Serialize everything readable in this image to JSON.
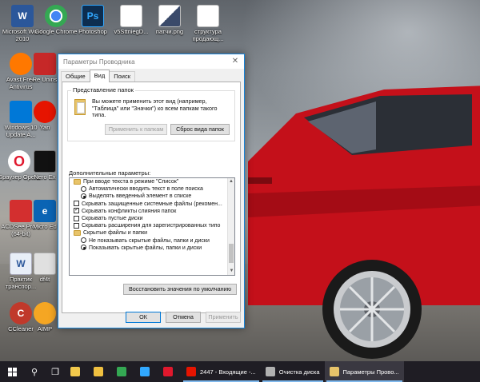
{
  "desktop": {
    "icons": [
      {
        "label": "Microsoft Word 2010",
        "icon": "word-icon",
        "color": "#2b579a",
        "glyph": "W"
      },
      {
        "label": "Google Chrome",
        "icon": "chrome-icon",
        "color": "#34a853",
        "glyph": ""
      },
      {
        "label": "Photoshop",
        "icon": "photoshop-icon",
        "color": "#0d2d4f",
        "glyph": "Ps"
      },
      {
        "label": "v5SttniegD...",
        "icon": "document-thumbnail-icon",
        "color": "#ffffff",
        "glyph": ""
      },
      {
        "label": "патчи.png",
        "icon": "image-thumbnail-icon",
        "color": "#ffffff",
        "glyph": ""
      },
      {
        "label": "структура продающ...",
        "icon": "image-thumbnail-icon",
        "color": "#ffffff",
        "glyph": ""
      },
      {
        "label": "Avast Free Antivirus",
        "icon": "avast-icon",
        "color": "#ff7800",
        "glyph": ""
      },
      {
        "label": "Re Unins",
        "icon": "uninstaller-icon",
        "color": "#c62828",
        "glyph": ""
      },
      {
        "label": "Windows 10 Update A...",
        "icon": "windows-update-icon",
        "color": "#0078d7",
        "glyph": ""
      },
      {
        "label": "Yan",
        "icon": "yandex-icon",
        "color": "#e61400",
        "glyph": ""
      },
      {
        "label": "Браузер Opera",
        "icon": "opera-icon",
        "color": "#e0182d",
        "glyph": "O"
      },
      {
        "label": "Nero Ex",
        "icon": "nero-icon",
        "color": "#111111",
        "glyph": ""
      },
      {
        "label": "ACDSee Pro 9 (64-bit)",
        "icon": "acdsee-icon",
        "color": "#d32f2f",
        "glyph": ""
      },
      {
        "label": "Micro Ed",
        "icon": "edge-icon",
        "color": "#0a64b4",
        "glyph": "e"
      },
      {
        "label": "Практик транспор...",
        "icon": "word-document-icon",
        "color": "#e8eef7",
        "glyph": "W"
      },
      {
        "label": "df4t",
        "icon": "document-icon",
        "color": "#e0e0e0",
        "glyph": ""
      },
      {
        "label": "CCleaner",
        "icon": "ccleaner-icon",
        "color": "#c0392b",
        "glyph": "C"
      },
      {
        "label": "AIMP",
        "icon": "aimp-icon",
        "color": "#f5a623",
        "glyph": ""
      }
    ]
  },
  "dialog": {
    "title": "Параметры Проводника",
    "tabs": [
      "Общие",
      "Вид",
      "Поиск"
    ],
    "active_tab": "Вид",
    "folder_views": {
      "label": "Представление папок",
      "description": "Вы можете применить этот вид (например, \"Таблица\" или \"Значки\") ко всем папкам такого типа.",
      "apply_button": "Применить к папкам",
      "reset_button": "Сброс вида папок"
    },
    "advanced_label": "Дополнительные параметры:",
    "advanced_items": [
      {
        "text": "При вводе текста в режиме \"Список\"",
        "kind": "folder",
        "level": 0
      },
      {
        "text": "Автоматически вводить текст в поле поиска",
        "kind": "radio",
        "checked": false,
        "level": 1
      },
      {
        "text": "Выделять введенный элемент в списке",
        "kind": "radio",
        "checked": true,
        "level": 1
      },
      {
        "text": "Скрывать защищенные системные файлы (рекомен...",
        "kind": "check",
        "checked": false,
        "level": 0
      },
      {
        "text": "Скрывать конфликты слияния папок",
        "kind": "check",
        "checked": true,
        "level": 0
      },
      {
        "text": "Скрывать пустые диски",
        "kind": "check",
        "checked": false,
        "level": 0
      },
      {
        "text": "Скрывать расширения для зарегистрированных типо",
        "kind": "check",
        "checked": false,
        "level": 0
      },
      {
        "text": "Скрытые файлы и папки",
        "kind": "folder",
        "level": 0
      },
      {
        "text": "Не показывать скрытые файлы, папки и диски",
        "kind": "radio",
        "checked": false,
        "level": 1
      },
      {
        "text": "Показывать скрытые файлы, папки и диски",
        "kind": "radio",
        "checked": true,
        "level": 1
      }
    ],
    "restore_button": "Восстановить значения по умолчанию",
    "ok_button": "ОК",
    "cancel_button": "Отмена",
    "apply_button": "Применить"
  },
  "taskbar": {
    "apps": [
      {
        "label": "",
        "icon": "steam-like-icon",
        "color": "#f2c94c"
      },
      {
        "label": "",
        "icon": "file-explorer-icon",
        "color": "#f0c040"
      },
      {
        "label": "",
        "icon": "chrome-icon",
        "color": "#34a853"
      },
      {
        "label": "",
        "icon": "photoshop-icon",
        "color": "#31a8ff"
      },
      {
        "label": "",
        "icon": "opera-icon",
        "color": "#e0182d"
      },
      {
        "label": "2447 - Входящие -...",
        "icon": "yandex-browser-icon",
        "color": "#e61400"
      },
      {
        "label": "Очистка диска",
        "icon": "disk-cleanup-icon",
        "color": "#b0b0b0"
      },
      {
        "label": "Параметры Прово...",
        "icon": "folder-options-icon",
        "color": "#e8c46a"
      }
    ]
  }
}
